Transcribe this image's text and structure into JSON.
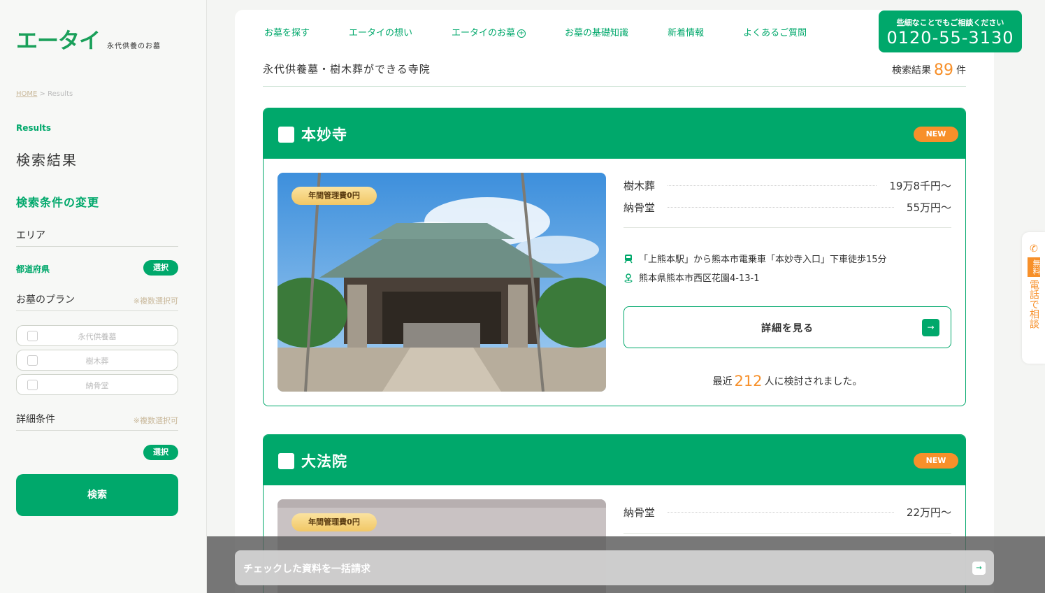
{
  "logo": {
    "main": "エータイ",
    "sub": "永代供養のお墓"
  },
  "breadcrumb": {
    "home": "HOME",
    "sep": ">",
    "current": "Results"
  },
  "sidebar": {
    "section_en": "Results",
    "section_title": "検索結果",
    "change_conditions": "検索条件の変更",
    "area_label": "エリア",
    "prefecture_label": "都道府県",
    "select_label": "選択",
    "plan_label": "お墓のプラン",
    "multi_note": "※複数選択可",
    "plans": [
      "永代供養墓",
      "樹木葬",
      "納骨堂"
    ],
    "detail_label": "詳細条件",
    "search_button": "検索"
  },
  "nav": {
    "items": [
      "お墓を探す",
      "エータイの想い",
      "エータイのお墓",
      "お墓の基礎知識",
      "新着情報",
      "よくあるご質問"
    ],
    "plus": "+"
  },
  "phone": {
    "note": "些細なことでもご相談ください",
    "number": "0120-55-3130"
  },
  "list": {
    "title": "永代供養墓・樹木葬ができる寺院",
    "count_prefix": "検索結果",
    "count": "89",
    "count_suffix": "件"
  },
  "cards": [
    {
      "name": "本妙寺",
      "new": "NEW",
      "badge": "年間管理費0円",
      "prices": [
        {
          "label": "樹木葬",
          "value": "19万8千円〜"
        },
        {
          "label": "納骨堂",
          "value": "55万円〜"
        }
      ],
      "access": "「上熊本駅」から熊本市電乗車「本妙寺入口」下車徒歩15分",
      "address": "熊本県熊本市西区花園4-13-1",
      "detail_button": "詳細を見る",
      "recent_prefix": "最近",
      "recent_count": "212",
      "recent_suffix": "人に検討されました。"
    },
    {
      "name": "大法院",
      "new": "NEW",
      "badge": "年間管理費0円",
      "prices": [
        {
          "label": "納骨堂",
          "value": "22万円〜"
        }
      ]
    }
  ],
  "side_tab": {
    "free": "無料",
    "consult": "電話で相談"
  },
  "bottom_bar": {
    "label": "チェックした資料を一括請求"
  },
  "colors": {
    "primary": "#00a86b",
    "accent": "#f7902a",
    "badge": "#f1c766"
  },
  "icons": [
    "train-icon",
    "pin-icon",
    "arrow-right-icon",
    "phone-icon",
    "plus-circle-icon"
  ]
}
